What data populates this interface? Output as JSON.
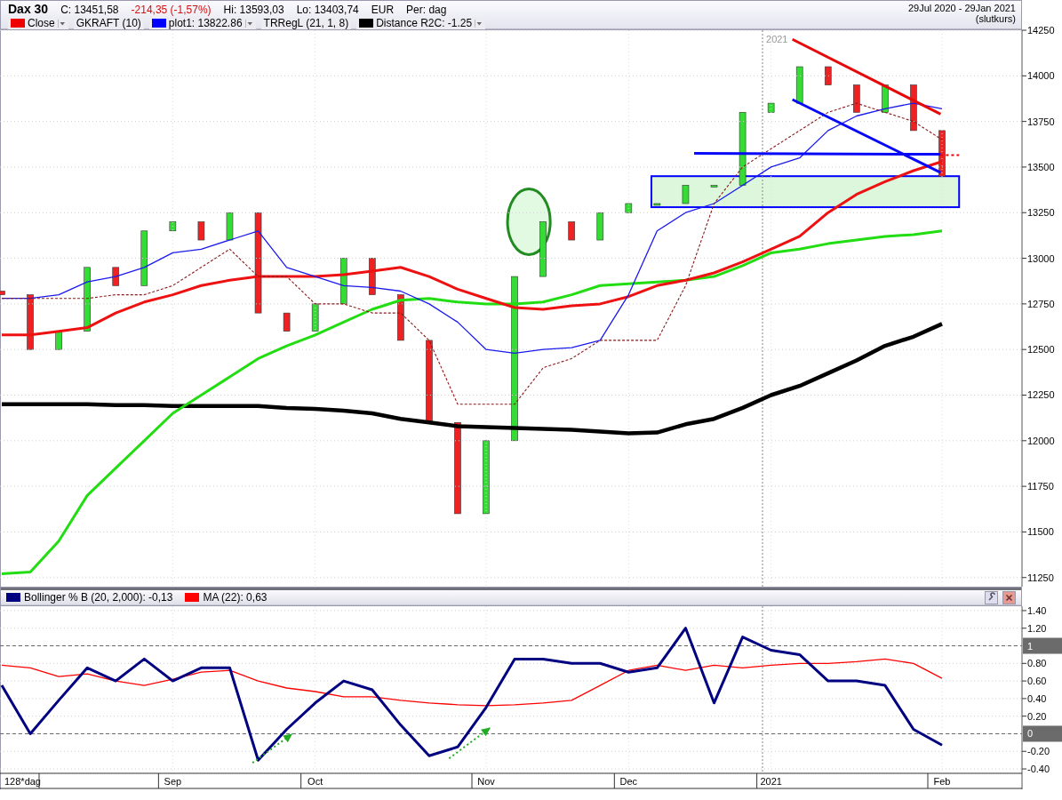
{
  "header": {
    "title": "Dax 30",
    "quote": [
      {
        "kind": "plain",
        "text": "C: 13451,58"
      },
      {
        "kind": "change",
        "text": "-214,35 (-1,57%)"
      },
      {
        "kind": "plain",
        "text": "Hi: 13593,03"
      },
      {
        "kind": "plain",
        "text": "Lo: 13403,74"
      },
      {
        "kind": "plain",
        "text": "EUR"
      },
      {
        "kind": "plain",
        "text": "Per: dag"
      }
    ],
    "legend": [
      {
        "label": "Close",
        "color": "#ee0000",
        "dropdown": true
      },
      {
        "label": "GKRAFT (10)",
        "dropdown": false
      },
      {
        "label": "plot1: 13822.86",
        "color": "#0000ff",
        "dropdown": true
      },
      {
        "label": "TRRegL (21, 1, 8)",
        "dropdown": false
      },
      {
        "label": "Distance R2C: -1.25",
        "color": "#000000",
        "dropdown": true
      }
    ],
    "date_range": "29Jul 2020 - 29Jan 2021",
    "price_basis": "(slutkurs)"
  },
  "price_chart": {
    "chart_data": {
      "type": "line",
      "grid": true,
      "ylim": [
        11200,
        14250
      ],
      "yticks": [
        {
          "value": 11250,
          "label": "11250"
        },
        {
          "value": 11500,
          "label": "11500"
        },
        {
          "value": 11750,
          "label": "11750"
        },
        {
          "value": 12000,
          "label": "12000"
        },
        {
          "value": 12250,
          "label": "12250"
        },
        {
          "value": 12500,
          "label": "12500"
        },
        {
          "value": 12750,
          "label": "12750"
        },
        {
          "value": 13000,
          "label": "13000"
        },
        {
          "value": 13250,
          "label": "13250"
        },
        {
          "value": 13500,
          "label": "13500"
        },
        {
          "value": 13750,
          "label": "13750"
        },
        {
          "value": 14000,
          "label": "14000"
        },
        {
          "value": 14250,
          "label": "14250"
        }
      ],
      "series": [
        {
          "color": "#000000",
          "values": [
            12200,
            12200,
            12200,
            12200,
            12195,
            12195,
            12190,
            12190,
            12190,
            12190,
            12180,
            12175,
            12165,
            12150,
            12120,
            12100,
            12080,
            12075,
            12070,
            12065,
            12060,
            12050,
            12040,
            12045,
            12090,
            12120,
            12180,
            12250,
            12300,
            12370,
            12440,
            12520,
            12570,
            12640
          ]
        },
        {
          "color": "#22dd11",
          "values": [
            11270,
            11280,
            11450,
            11700,
            11850,
            12000,
            12150,
            12250,
            12350,
            12450,
            12520,
            12580,
            12650,
            12720,
            12770,
            12780,
            12760,
            12750,
            12750,
            12760,
            12800,
            12850,
            12860,
            12870,
            12880,
            12900,
            12960,
            13030,
            13050,
            13080,
            13100,
            13120,
            13130,
            13150
          ]
        },
        {
          "color": "#ee1111",
          "values": [
            12580,
            12580,
            12600,
            12620,
            12700,
            12760,
            12800,
            12850,
            12880,
            12900,
            12900,
            12900,
            12910,
            12930,
            12950,
            12900,
            12830,
            12780,
            12730,
            12720,
            12740,
            12750,
            12790,
            12850,
            12880,
            12920,
            12980,
            13050,
            13120,
            13250,
            13350,
            13420,
            13480,
            13530
          ]
        },
        {
          "color": "#1a1aee",
          "values": [
            12780,
            12780,
            12800,
            12870,
            12900,
            12950,
            13030,
            13050,
            13100,
            13150,
            12950,
            12900,
            12850,
            12840,
            12820,
            12750,
            12650,
            12500,
            12480,
            12500,
            12510,
            12550,
            12800,
            13150,
            13250,
            13300,
            13400,
            13500,
            13550,
            13700,
            13780,
            13820,
            13850,
            13820
          ]
        },
        {
          "color": "#8b1a1a",
          "line_style": "dashed",
          "values": [
            12780,
            12780,
            12780,
            12780,
            12800,
            12800,
            12850,
            12950,
            13050,
            12900,
            12900,
            12750,
            12750,
            12700,
            12700,
            12550,
            12200,
            12200,
            12200,
            12400,
            12450,
            12550,
            12550,
            12550,
            12850,
            13300,
            13500,
            13600,
            13700,
            13800,
            13850,
            13800,
            13750,
            13650
          ]
        }
      ],
      "annotations": [
        "2021"
      ]
    }
  },
  "indicator_panel": {
    "legend": [
      {
        "label": "Bollinger % B (20, 2,000): -0,13",
        "color": "#000080"
      },
      {
        "label": "MA (22): 0,63",
        "color": "#ff0000"
      }
    ],
    "period_label": "128*dag",
    "chart_data": {
      "type": "line",
      "grid": true,
      "ylim": [
        -0.45,
        1.45
      ],
      "categories": [
        null,
        null,
        null,
        null,
        null,
        null,
        "Sep",
        null,
        null,
        null,
        null,
        "Oct",
        null,
        null,
        null,
        null,
        null,
        "Nov",
        null,
        null,
        null,
        null,
        "Dec",
        null,
        null,
        null,
        null,
        "2021",
        null,
        null,
        null,
        null,
        null,
        "Feb"
      ],
      "yticks": [
        {
          "value": 1.4,
          "label": "1.40"
        },
        {
          "value": 1.2,
          "label": "1.20"
        },
        {
          "value": 1,
          "label": "1"
        },
        {
          "value": 0.8,
          "label": "0.80"
        },
        {
          "value": 0.6,
          "label": "0.60"
        },
        {
          "value": 0.4,
          "label": "0.40"
        },
        {
          "value": 0.2,
          "label": "0.20"
        },
        {
          "value": 0,
          "label": "0"
        },
        {
          "value": -0.2,
          "label": "-0.20"
        },
        {
          "value": -0.4,
          "label": "-0.40"
        }
      ],
      "series": [
        {
          "color": "#ff0000",
          "values": [
            0.78,
            0.75,
            0.65,
            0.68,
            0.6,
            0.55,
            0.62,
            0.7,
            0.72,
            0.6,
            0.52,
            0.48,
            0.42,
            0.42,
            0.38,
            0.35,
            0.33,
            0.32,
            0.33,
            0.35,
            0.38,
            0.55,
            0.72,
            0.78,
            0.72,
            0.78,
            0.75,
            0.78,
            0.8,
            0.8,
            0.82,
            0.85,
            0.8,
            0.63
          ]
        },
        {
          "color": "#000080",
          "values": [
            0.55,
            0.0,
            0.38,
            0.75,
            0.6,
            0.85,
            0.6,
            0.75,
            0.75,
            -0.3,
            0.05,
            0.35,
            0.6,
            0.5,
            0.1,
            -0.25,
            -0.15,
            0.3,
            0.85,
            0.85,
            0.8,
            0.8,
            0.7,
            0.75,
            1.2,
            0.35,
            1.1,
            0.95,
            0.9,
            0.6,
            0.6,
            0.55,
            0.05,
            -0.13
          ]
        }
      ]
    }
  }
}
